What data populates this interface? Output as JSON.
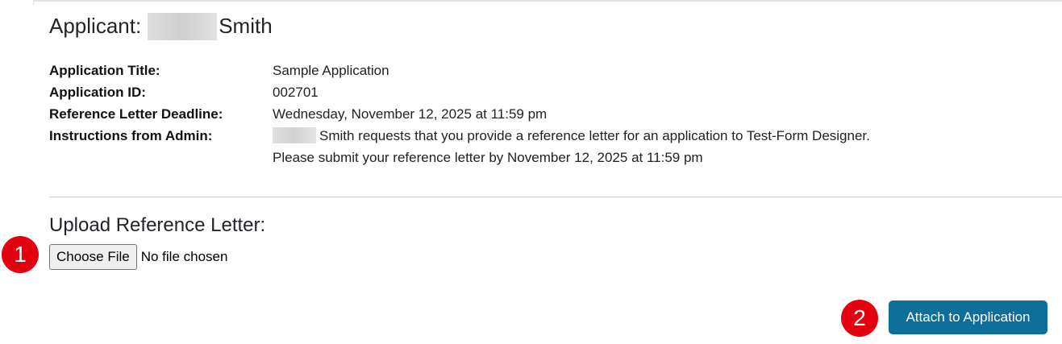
{
  "applicant": {
    "label": "Applicant:",
    "last_name": "Smith"
  },
  "details": [
    {
      "label": "Application Title:",
      "value": "Sample Application"
    },
    {
      "label": "Application ID:",
      "value": "002701"
    },
    {
      "label": "Reference Letter Deadline:",
      "value": "Wednesday, November 12, 2025 at 11:59 pm"
    },
    {
      "label": "Instructions from Admin:",
      "value": "Smith requests that you provide a reference letter for an application to Test-Form Designer."
    }
  ],
  "instructions_line2": "Please submit your reference letter by November 12, 2025 at 11:59 pm",
  "upload": {
    "heading": "Upload Reference Letter:",
    "choose_file_label": "Choose File",
    "file_status": "No file chosen"
  },
  "attach_button_label": "Attach to Application",
  "callouts": {
    "first": "1",
    "second": "2"
  },
  "colors": {
    "primary_button": "#0d6e99",
    "callout": "#e3000f"
  }
}
